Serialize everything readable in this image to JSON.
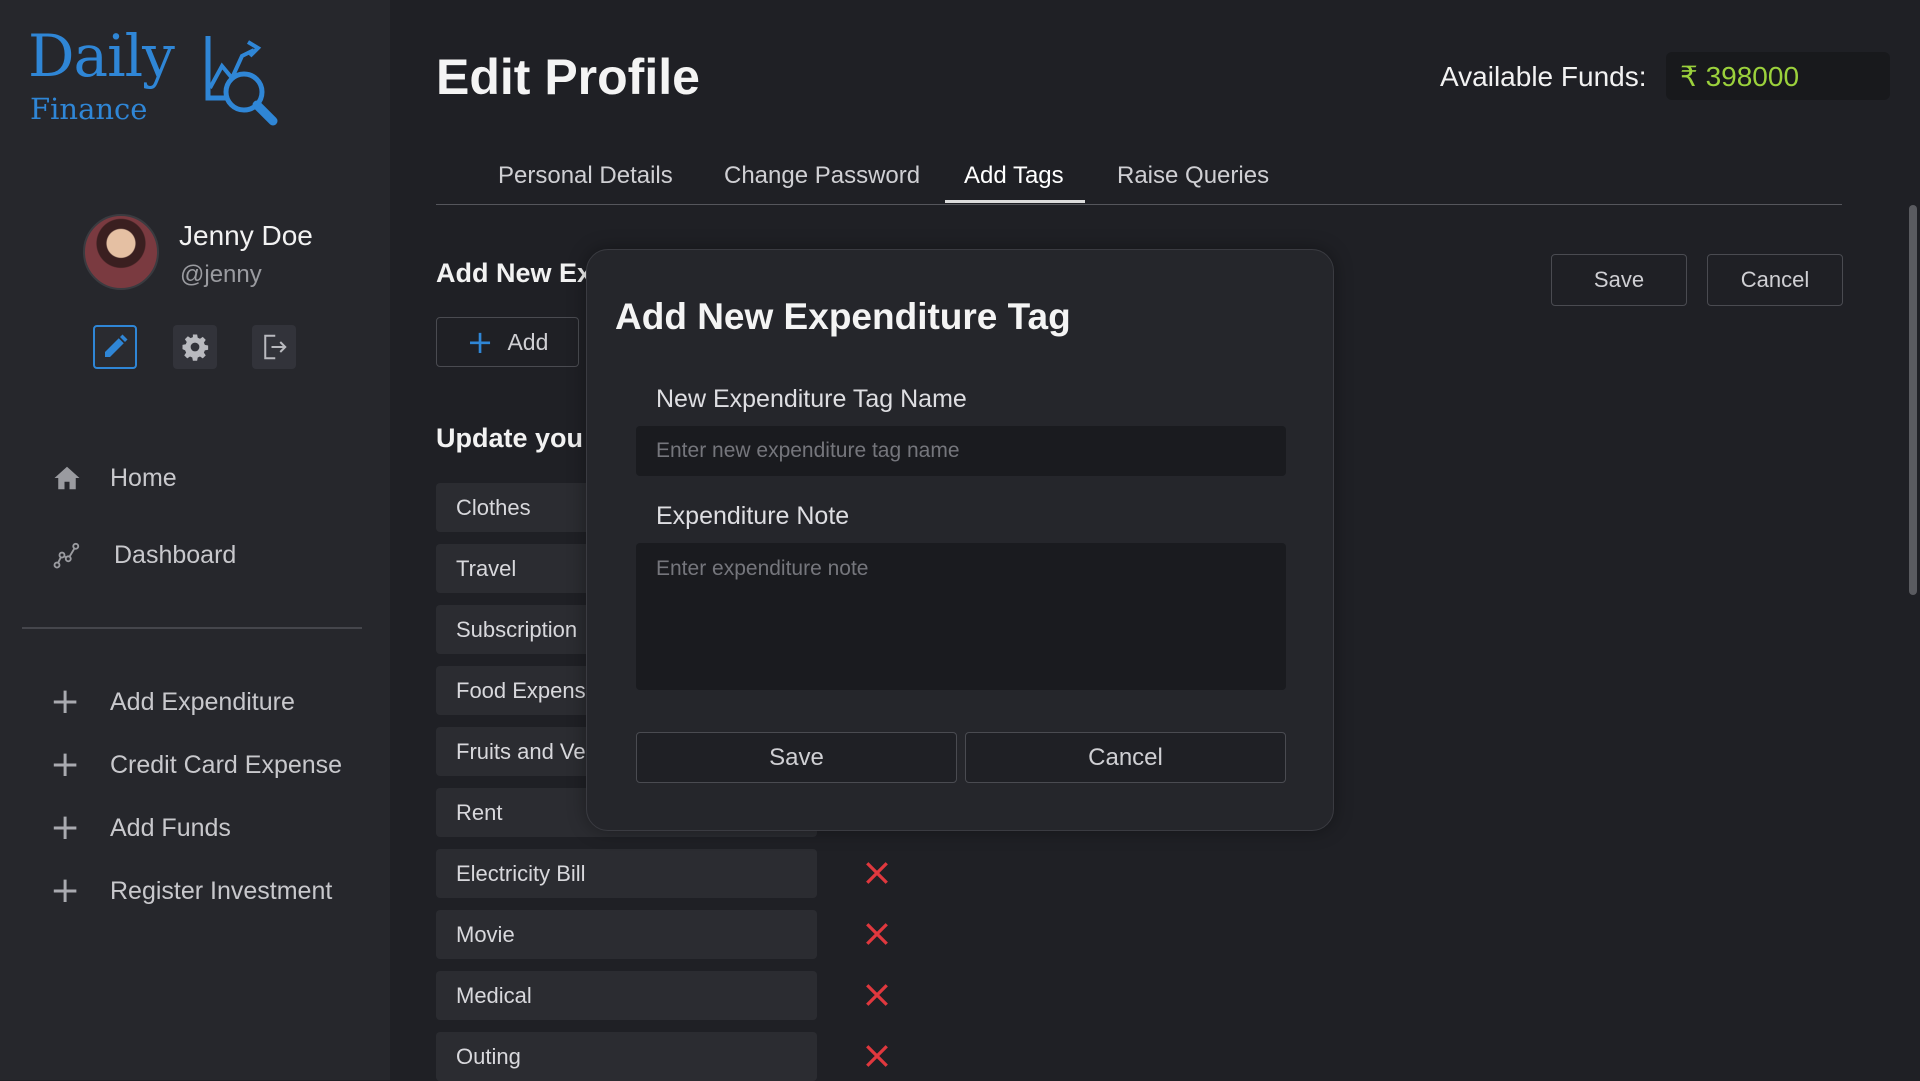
{
  "logo": {
    "daily": "Daily",
    "finance": "Finance"
  },
  "profile": {
    "name": "Jenny Doe",
    "handle": "@jenny"
  },
  "sidebar": {
    "nav": [
      {
        "label": "Home"
      },
      {
        "label": "Dashboard"
      }
    ],
    "actions": [
      {
        "label": "Add Expenditure"
      },
      {
        "label": "Credit Card Expense"
      },
      {
        "label": "Add Funds"
      },
      {
        "label": "Register Investment"
      }
    ]
  },
  "header": {
    "title": "Edit Profile",
    "funds_label": "Available Funds:",
    "funds_value": "₹ 398000"
  },
  "tabs": [
    {
      "label": "Personal Details"
    },
    {
      "label": "Change Password"
    },
    {
      "label": "Add Tags"
    },
    {
      "label": "Raise Queries"
    }
  ],
  "main": {
    "add_section_title": "Add New Ex",
    "add_button": "Add",
    "update_section_title": "Update you",
    "save_button": "Save",
    "cancel_button": "Cancel",
    "tags": [
      "Clothes",
      "Travel",
      "Subscription",
      "Food Expense",
      "Fruits and Veg",
      "Rent",
      "Electricity Bill",
      "Movie",
      "Medical",
      "Outing"
    ]
  },
  "modal": {
    "title": "Add New Expenditure Tag",
    "name_label": "New Expenditure Tag Name",
    "name_placeholder": "Enter new expenditure tag name",
    "note_label": "Expenditure Note",
    "note_placeholder": "Enter expenditure note",
    "save": "Save",
    "cancel": "Cancel"
  },
  "colors": {
    "accent": "#2f86d6",
    "funds": "#9bd13c",
    "delete": "#e0383e"
  }
}
